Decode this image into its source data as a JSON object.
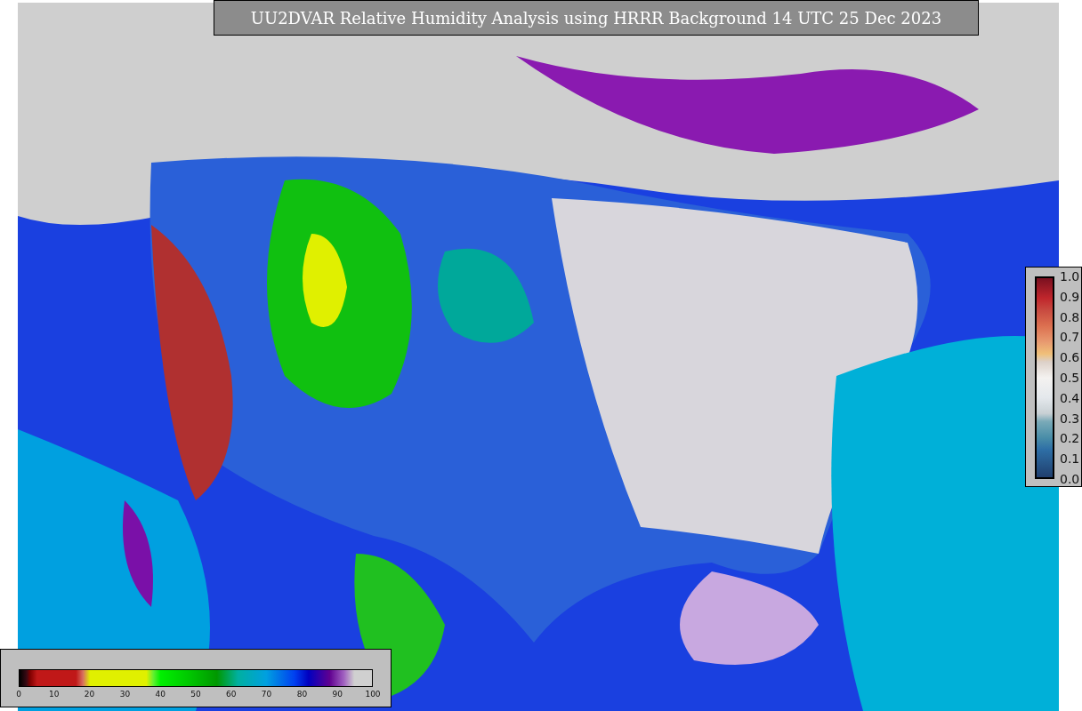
{
  "title": "UU2DVAR Relative Humidity Analysis using HRRR Background 14 UTC 25 Dec 2023",
  "station_colorbar": {
    "ticks": [
      "1.0",
      "0.9",
      "0.8",
      "0.7",
      "0.6",
      "0.5",
      "0.4",
      "0.3",
      "0.2",
      "0.1",
      "0.0"
    ]
  },
  "humidity_colorbar": {
    "ticks": [
      "0",
      "10",
      "20",
      "30",
      "40",
      "50",
      "60",
      "70",
      "80",
      "90",
      "100"
    ]
  }
}
